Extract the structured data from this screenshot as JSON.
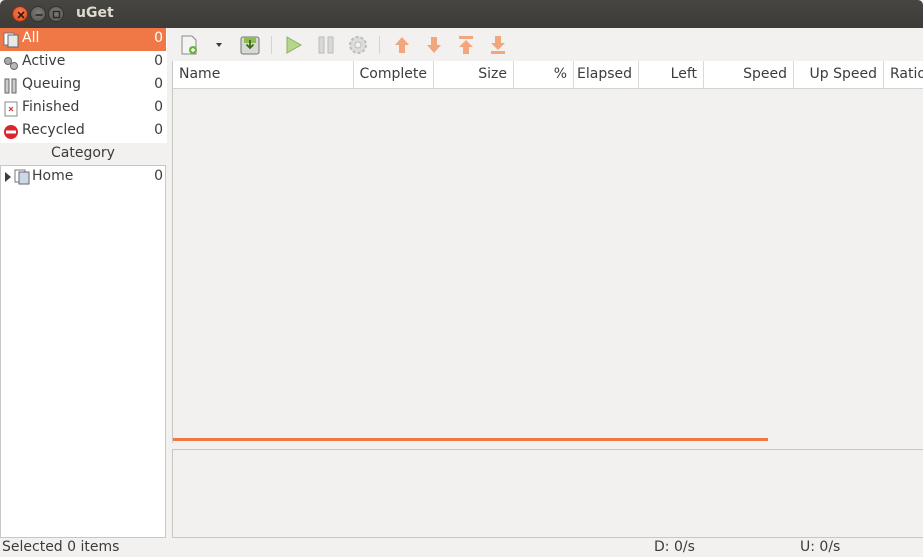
{
  "window": {
    "title": "uGet"
  },
  "states": [
    {
      "label": "All",
      "count": "0",
      "icon": "all-downloads-icon",
      "selected": true
    },
    {
      "label": "Active",
      "count": "0",
      "icon": "active-gears-icon"
    },
    {
      "label": "Queuing",
      "count": "0",
      "icon": "queuing-pause-icon"
    },
    {
      "label": "Finished",
      "count": "0",
      "icon": "finished-file-icon"
    },
    {
      "label": "Recycled",
      "count": "0",
      "icon": "recycled-no-entry-icon"
    }
  ],
  "category": {
    "header": "Category",
    "items": [
      {
        "label": "Home",
        "count": "0",
        "icon": "category-folder-icon"
      }
    ]
  },
  "toolbar": {
    "buttons": [
      "new-download-icon",
      "dropdown-arrow-icon",
      "save-download-icon",
      "start-play-icon",
      "pause-icon",
      "properties-gear-icon",
      "move-up-icon",
      "move-down-icon",
      "move-top-icon",
      "move-bottom-icon"
    ]
  },
  "columns": [
    "Name",
    "Complete",
    "Size",
    "%",
    "Elapsed",
    "Left",
    "Speed",
    "Up Speed",
    "Ratio"
  ],
  "statusbar": {
    "selected": "Selected 0 items",
    "download": "D:  0/s",
    "upload": "U:  0/s"
  },
  "colors": {
    "accent": "#f07746",
    "titlebar": "#3c3b37",
    "close": "#df4a16",
    "window_bg": "#f2f1f0"
  }
}
